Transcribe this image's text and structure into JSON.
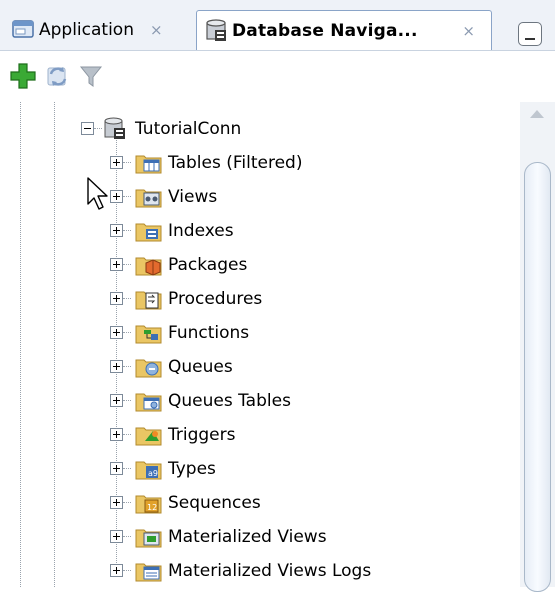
{
  "tabs": [
    {
      "label": "Application",
      "close": "×",
      "icon": "application-icon",
      "active": false
    },
    {
      "label": "Database Naviga...",
      "close": "×",
      "icon": "database-navigator-icon",
      "active": true
    }
  ],
  "toolbar": {
    "buttons": [
      {
        "name": "add-connection-button",
        "icon": "green-plus-icon"
      },
      {
        "name": "refresh-button",
        "icon": "refresh-icon"
      },
      {
        "name": "filter-button",
        "icon": "filter-funnel-icon"
      }
    ]
  },
  "tree": {
    "root": {
      "label": "TutorialConn",
      "icon": "database-connection-icon",
      "expanded": true
    },
    "children": [
      {
        "label": "Tables (Filtered)",
        "icon": "tables-folder-icon"
      },
      {
        "label": "Views",
        "icon": "views-folder-icon"
      },
      {
        "label": "Indexes",
        "icon": "indexes-folder-icon"
      },
      {
        "label": "Packages",
        "icon": "packages-folder-icon"
      },
      {
        "label": "Procedures",
        "icon": "procedures-folder-icon"
      },
      {
        "label": "Functions",
        "icon": "functions-folder-icon"
      },
      {
        "label": "Queues",
        "icon": "queues-folder-icon"
      },
      {
        "label": "Queues Tables",
        "icon": "queues-tables-folder-icon"
      },
      {
        "label": "Triggers",
        "icon": "triggers-folder-icon"
      },
      {
        "label": "Types",
        "icon": "types-folder-icon"
      },
      {
        "label": "Sequences",
        "icon": "sequences-folder-icon"
      },
      {
        "label": "Materialized Views",
        "icon": "materialized-views-folder-icon"
      },
      {
        "label": "Materialized Views Logs",
        "icon": "materialized-views-logs-folder-icon"
      }
    ]
  },
  "colors": {
    "tab_strip_bg": "#eef2f8",
    "folder": "#e9c46a",
    "accent_green": "#2e9e2e",
    "accent_blue": "#3d6fb5"
  }
}
